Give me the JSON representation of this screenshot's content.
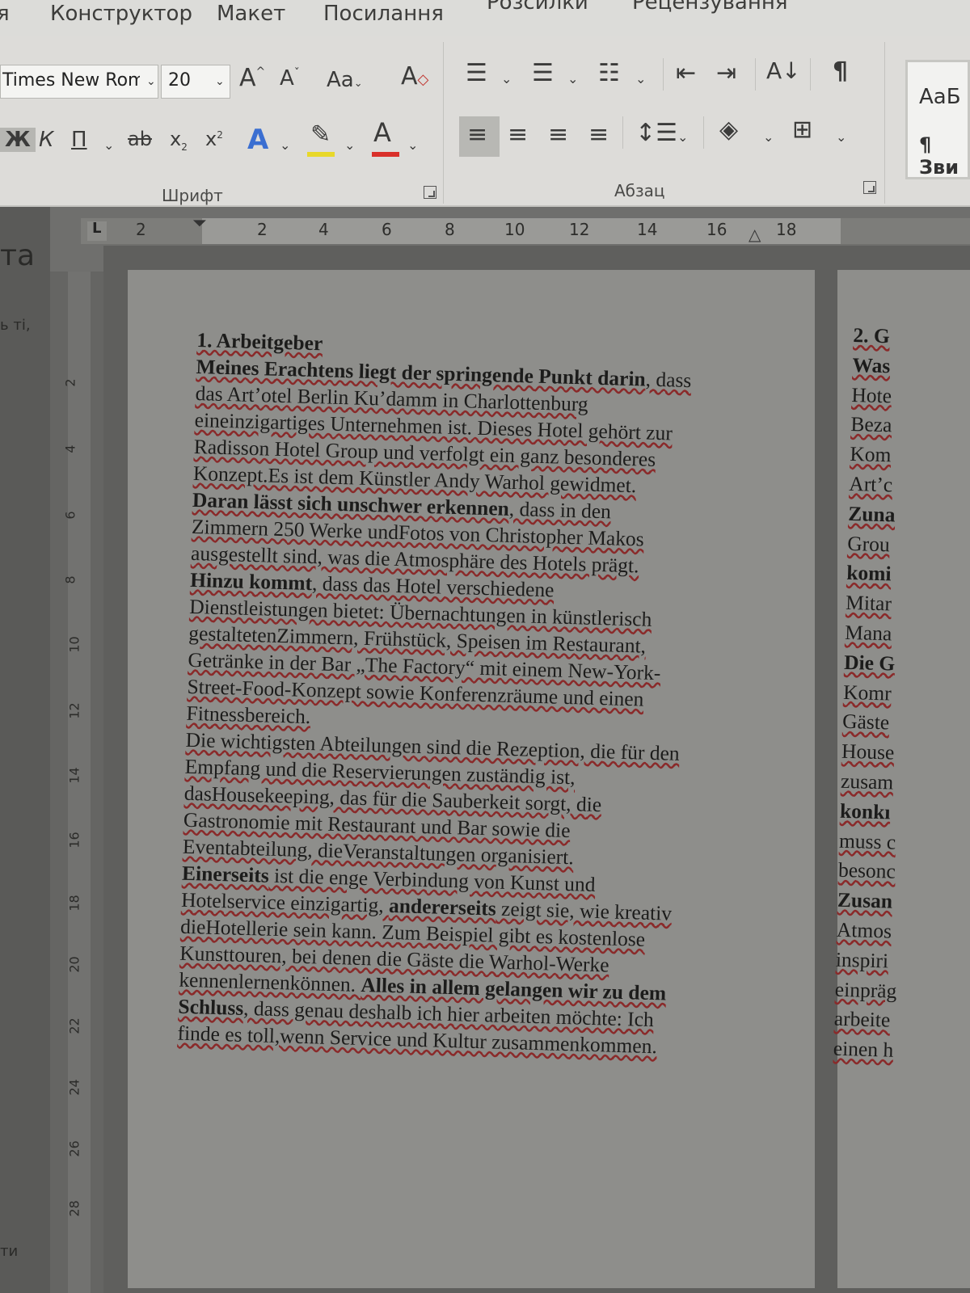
{
  "ribbon": {
    "tabs": [
      "я",
      "Конструктор",
      "Макет",
      "Посилання",
      "Розсилки",
      "Рецензування"
    ],
    "font_name": "Times New Roma",
    "font_size": "20",
    "font_group_label": "Шрифт",
    "paragraph_group_label": "Абзац",
    "style_normal": "АаБ",
    "style_heading": "¶ Зви",
    "btn_grow_font": "A",
    "btn_shrink_font": "A",
    "btn_change_case": "Aa",
    "btn_bold": "Ж",
    "btn_italic": "К",
    "btn_underline": "П",
    "btn_strike": "ab",
    "btn_subscript": "x",
    "btn_superscript": "x",
    "btn_text_effects": "A",
    "btn_font_color": "A",
    "btn_sort": "А↓",
    "btn_pilcrow": "¶",
    "colors": {
      "highlight": "#e8d82a",
      "font_color": "#d9302a",
      "text_effects": "#3b6fd1"
    }
  },
  "ruler": {
    "horizontal": [
      "2",
      "2",
      "4",
      "6",
      "8",
      "10",
      "12",
      "14",
      "16",
      "18"
    ],
    "vertical": [
      "2",
      "4",
      "6",
      "8",
      "10",
      "12",
      "14",
      "16",
      "18",
      "20",
      "22",
      "24",
      "26",
      "28"
    ],
    "tab_selector": "L"
  },
  "left_pane": {
    "title_fragment": "та",
    "line1": "ь ті,",
    "line2": "ти"
  },
  "document": {
    "page1": {
      "heading": "1. Arbeitgeber",
      "paragraph1_lines": [
        {
          "bold": "Meines Erachtens liegt der springende Punkt darin",
          "rest": ", dass"
        },
        {
          "bold": "",
          "rest": "das Art’otel Berlin Ku’damm in Charlottenburg"
        },
        {
          "bold": "",
          "rest": "eineinzigartiges Unternehmen ist. Dieses Hotel gehört zur"
        },
        {
          "bold": "",
          "rest": "Radisson Hotel Group und verfolgt ein ganz besonderes"
        },
        {
          "bold": "",
          "rest": "Konzept.Es ist dem Künstler Andy Warhol gewidmet."
        },
        {
          "bold": "Daran lässt sich unschwer erkennen",
          "rest": ", dass in den"
        },
        {
          "bold": "",
          "rest": "Zimmern 250 Werke undFotos von Christopher Makos"
        },
        {
          "bold": "",
          "rest": "ausgestellt sind, was die Atmosphäre des Hotels prägt."
        },
        {
          "bold": "Hinzu kommt",
          "rest": ", dass das Hotel verschiedene"
        },
        {
          "bold": "",
          "rest": "Dienstleistungen bietet: Übernachtungen in künstlerisch"
        },
        {
          "bold": "",
          "rest": "gestaltetenZimmern, Frühstück, Speisen im Restaurant,"
        },
        {
          "bold": "",
          "rest": "Getränke in der Bar „The Factory“ mit einem New-York-"
        },
        {
          "bold": "",
          "rest": "Street-Food-Konzept sowie Konferenzräume und einen"
        },
        {
          "bold": "",
          "rest": "Fitnessbereich."
        }
      ],
      "paragraph2_lines": [
        {
          "pre": "",
          "bold": "",
          "rest": "Die wichtigsten Abteilungen sind die Rezeption, die für den"
        },
        {
          "pre": "",
          "bold": "",
          "rest": "Empfang und die Reservierungen zuständig ist,"
        },
        {
          "pre": "",
          "bold": "",
          "rest": "dasHousekeeping, das für die Sauberkeit sorgt, die"
        },
        {
          "pre": "",
          "bold": "",
          "rest": "Gastronomie mit Restaurant und Bar sowie die"
        },
        {
          "pre": "",
          "bold": "",
          "rest": "Eventabteilung, dieVeranstaltungen organisiert."
        },
        {
          "pre": "",
          "bold": "Einerseits",
          "rest": " ist die enge Verbindung von Kunst und"
        },
        {
          "pre": "Hotelservice einzigartig, ",
          "bold": "andererseits",
          "rest": " zeigt sie, wie kreativ"
        },
        {
          "pre": "",
          "bold": "",
          "rest": "dieHotellerie sein kann. Zum Beispiel gibt es kostenlose"
        },
        {
          "pre": "",
          "bold": "",
          "rest": "Kunsttouren, bei denen die Gäste die Warhol-Werke"
        },
        {
          "pre": "kennenlernenkönnen. ",
          "bold": "Alles in allem gelangen wir zu dem",
          "rest": ""
        },
        {
          "pre": "",
          "bold": "Schluss",
          "rest": ", dass genau deshalb ich hier arbeiten möchte: Ich"
        },
        {
          "pre": "",
          "bold": "",
          "rest": "finde es toll,wenn Service und Kultur zusammenkommen."
        }
      ]
    },
    "page2_fragments": [
      "2. G",
      "Was",
      "Hote",
      "Beza",
      "Kom",
      "Art’c",
      "Zuna",
      "Grou",
      "komi",
      "Mitar",
      "Mana",
      "Die G",
      "Komr",
      "Gäste",
      "House",
      "zusam",
      "konkı",
      "muss c",
      "besonc",
      "Zusan",
      "Atmos",
      "inspiri",
      "einpräg",
      "arbeite",
      "einen h"
    ]
  }
}
